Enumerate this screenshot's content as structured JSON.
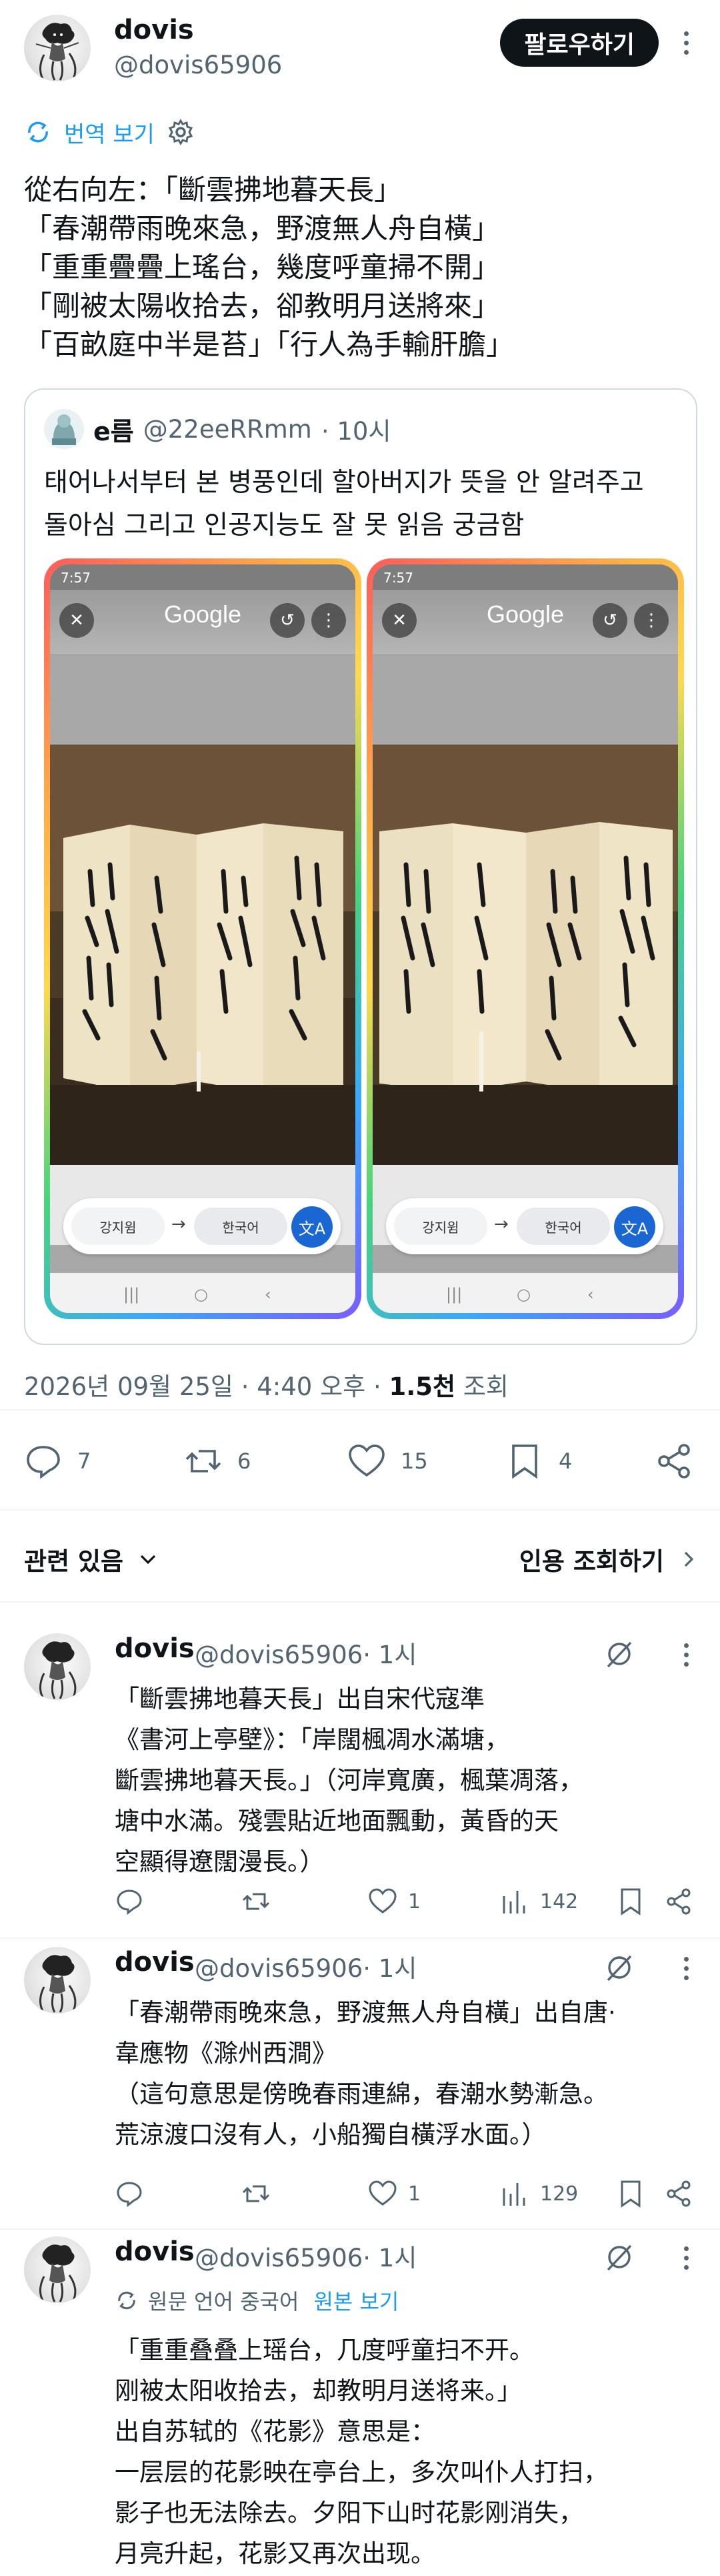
{
  "post": {
    "author_name": "dovis",
    "author_handle": "@dovis65906",
    "follow_label": "팔로우하기",
    "translate_label": "번역 보기",
    "text_lines": [
      "從右向左：「斷雲拂地暮天長」",
      "「春潮帶雨晚來急，野渡無人舟自橫」",
      "「重重疊疊上瑤台，幾度呼童掃不開」",
      "「剛被太陽收拾去，卻教明月送將來」",
      "「百畝庭中半是苔」「行人為手輸肝膽」"
    ],
    "timestamp": "2026년 09월 25일 · 4:40 오후 · ",
    "views_count": "1.5천",
    "views_label": " 조회"
  },
  "quote": {
    "name": "e름",
    "handle": "@22eeRRmm",
    "time": "· 10시",
    "text_lines": [
      "태어나서부터 본 병풍인데 할아버지가 뜻을 안 알려주고",
      "돌아심 그리고 인공지능도 잘 못 읽음 궁금함"
    ],
    "phones": [
      {
        "time": "7:57",
        "logo": "Google",
        "lens_label": "강지윔",
        "lang_label": "한국어"
      },
      {
        "time": "7:57",
        "logo": "Google",
        "lens_label": "강지윔",
        "lang_label": "한국어"
      }
    ]
  },
  "actions": {
    "replies": "7",
    "reposts": "6",
    "likes": "15",
    "bookmarks": "4"
  },
  "related": {
    "left_label": "관련 있음",
    "right_label": "인용 조회하기"
  },
  "replies": [
    {
      "name": "dovis",
      "handle": "@dovis65906",
      "time": "· 1시",
      "lines": [
        "「斷雲拂地暮天長」出自宋代寇準",
        "《書河上亭壁》：「岸闊楓凋水滿塘，",
        "斷雲拂地暮天長。」（河岸寬廣，楓葉凋落，",
        "塘中水滿。殘雲貼近地面飄動，黃昏的天",
        "空顯得遼闊漫長。）"
      ],
      "likes": "1",
      "views": "142"
    },
    {
      "name": "dovis",
      "handle": "@dovis65906",
      "time": "· 1시",
      "lines": [
        "「春潮帶雨晚來急，野渡無人舟自橫」出自唐·",
        "韋應物《滁州西澗》",
        "（這句意思是傍晚春雨連綿，春潮水勢漸急。",
        "荒涼渡口沒有人，小船獨自橫浮水面。）"
      ],
      "likes": "1",
      "views": "129"
    },
    {
      "name": "dovis",
      "handle": "@dovis65906",
      "time": "· 1시",
      "orig_label": "원문 언어 중국어",
      "orig_link": "원본 보기",
      "lines": [
        "「重重叠叠上瑶台，几度呼童扫不开。",
        "刚被太阳收拾去，却教明月送将来。」",
        "出自苏轼的《花影》意思是：",
        "一层层的花影映在亭台上，多次叫仆人打扫，",
        "影子也无法除去。夕阳下山时花影刚消失，",
        "月亮升起，花影又再次出现。"
      ]
    }
  ],
  "colors": {
    "link": "#1d9bf0",
    "secondary_text": "#536471",
    "primary_text": "#0f1419",
    "divider": "#eff3f4"
  }
}
